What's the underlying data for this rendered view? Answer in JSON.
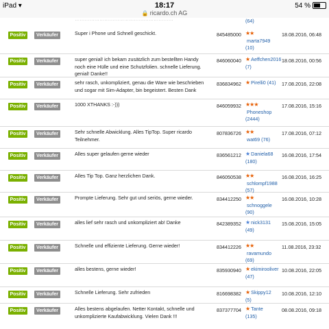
{
  "status": {
    "device": "iPad",
    "wifi": "wifi-icon",
    "time": "18:17",
    "url": "ricardo.ch AG",
    "battery_text": "54 %",
    "battery_percent": 54
  },
  "top_fragment": {
    "count": "(64)"
  },
  "rows": [
    {
      "rating": "Positiv",
      "role": "Verkäufer",
      "comment": "Super i Phone und Schnell geschickt.",
      "article": "845485000",
      "user": "marta7949",
      "score": "(10)",
      "stars": "★★",
      "star_style": "orange",
      "date": "18.08.2016, 06:48"
    },
    {
      "rating": "Positiv",
      "role": "Verkäufer",
      "comment": "super genial! ich bekam zusätzlich zum bestellten Handy noch eine Hülle und eine Schutzfolien. schnelle Lieferung. genial! Danke!!",
      "article": "846060040",
      "user": "Aeffchen2016",
      "score": "(7)",
      "stars": "★",
      "star_style": "orange",
      "date": "18.08.2016, 00:56"
    },
    {
      "rating": "Positiv",
      "role": "Verkäufer",
      "comment": "sehr rasch, unkompliziert, genau die Ware wie beschrieben und sogar mit Sim-Adapter, bin begeistert. Besten Dank",
      "article": "836834962",
      "user": "Pirelli0 (41)",
      "score": "",
      "stars": "★",
      "star_style": "orange",
      "date": "17.08.2016, 22:08"
    },
    {
      "rating": "Positiv",
      "role": "Verkäufer",
      "comment": "1000 XTHANKS :-)))",
      "article": "846059932",
      "user": "Phoneshop",
      "score": "(2444)",
      "stars": "★★★",
      "star_style": "mix",
      "date": "17.08.2016, 15:16"
    },
    {
      "rating": "Positiv",
      "role": "Verkäufer",
      "comment": "Sehr schnelle Abwicklung. Alles TipTop. Super ricardo Teilnehmer.",
      "article": "807836726",
      "user": "wat69 (76)",
      "score": "",
      "stars": "★★",
      "star_style": "orange",
      "date": "17.08.2016, 07:12"
    },
    {
      "rating": "Positiv",
      "role": "Verkäufer",
      "comment": "Alles super gelaufen gerne wieder",
      "article": "836561212",
      "user": "Daniela68",
      "score": "(180)",
      "stars": "★",
      "star_style": "blue",
      "date": "16.08.2016, 17:54"
    },
    {
      "rating": "Positiv",
      "role": "Verkäufer",
      "comment": "Alles Tip Top. Ganz herzlichen Dank.",
      "article": "846050538",
      "user": "schlompf1988",
      "score": "(57)",
      "stars": "★★",
      "star_style": "orange",
      "date": "16.08.2016, 16:25"
    },
    {
      "rating": "Positiv",
      "role": "Verkäufer",
      "comment": "Prompte Lieferung. Sehr gut und seriös, gerne wieder.",
      "article": "834412250",
      "user": "schnoggele",
      "score": "(90)",
      "stars": "★★",
      "star_style": "orange",
      "date": "16.08.2016, 10:28"
    },
    {
      "rating": "Positiv",
      "role": "Verkäufer",
      "comment": "alles lief sehr rasch und unkompliziert ab! Danke",
      "article": "842389352",
      "user": "nick3131",
      "score": "(49)",
      "stars": "★",
      "star_style": "blue",
      "date": "15.08.2016, 15:05"
    },
    {
      "rating": "Positiv",
      "role": "Verkäufer",
      "comment": "Schnelle und effiziente Lieferung. Gerne wieder!",
      "article": "834412226",
      "user": "ravamundo",
      "score": "(69)",
      "stars": "★★",
      "star_style": "orange",
      "date": "11.08.2016, 23:32"
    },
    {
      "rating": "Positiv",
      "role": "Verkäufer",
      "comment": "alles bestens, gerne wieder!",
      "article": "835930940",
      "user": "ekimirooliver",
      "score": "(47)",
      "stars": "★",
      "star_style": "orange",
      "date": "10.08.2016, 22:05"
    },
    {
      "rating": "Positiv",
      "role": "Verkäufer",
      "comment": "Schnelle Lieferung. Sehr zufrieden",
      "article": "816698382",
      "user": "Skippy12",
      "score": "(5)",
      "stars": "★",
      "star_style": "orange",
      "date": "10.08.2016, 12:10"
    },
    {
      "rating": "Positiv",
      "role": "Verkäufer",
      "comment": "Alles bestens abgelaufen. Netter Kontakt, schnelle und unkomplizierte Kaufabwicklung. Vielen Dank !!!",
      "article": "837377704",
      "user": "Tante",
      "score": "(135)",
      "stars": "★",
      "star_style": "orange",
      "date": "08.08.2016, 09:18"
    }
  ]
}
